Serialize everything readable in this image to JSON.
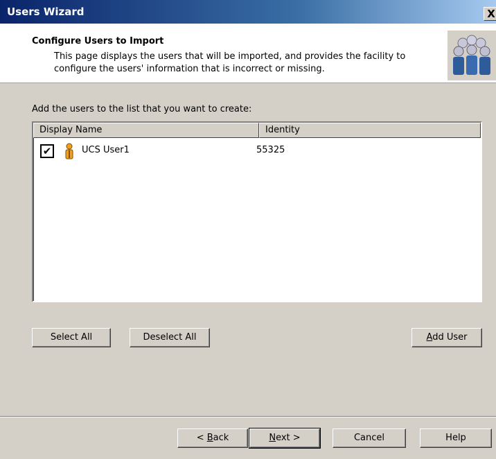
{
  "window": {
    "title": "Users Wizard",
    "close_symbol": "X"
  },
  "header": {
    "title": "Configure Users to Import",
    "description": "This page displays the users that will be imported, and provides the facility to configure the users' information that is incorrect or missing.",
    "icon": "users-group-icon"
  },
  "main": {
    "instruction": "Add the users to the list that you want to create:",
    "list": {
      "columns": [
        "Display Name",
        "Identity"
      ],
      "rows": [
        {
          "checked": true,
          "check_symbol": "✔",
          "icon": "user-icon",
          "display_name": "UCS User1",
          "identity": "55325"
        }
      ]
    },
    "buttons": {
      "select_all": "Select All",
      "deselect_all": "Deselect All",
      "add_user_mnemonic": "A",
      "add_user_rest": "dd User"
    }
  },
  "footer": {
    "back_prefix": "< ",
    "back_mnemonic": "B",
    "back_rest": "ack",
    "next_mnemonic": "N",
    "next_rest": "ext >",
    "cancel": "Cancel",
    "help": "Help"
  },
  "colors": {
    "title_bar": "#0a246a",
    "dialog_face": "#d4d0c8",
    "user_icon": "#f0a020"
  }
}
